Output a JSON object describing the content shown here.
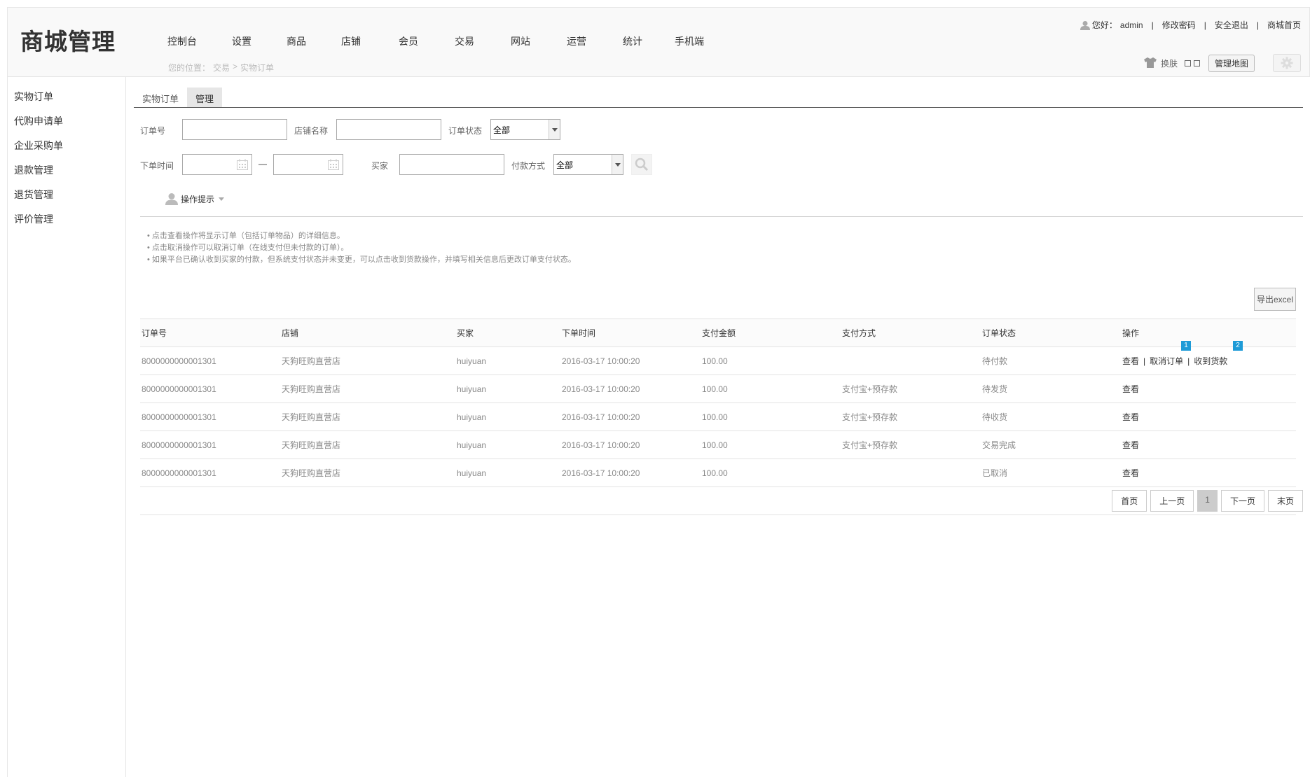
{
  "header": {
    "logo": "商城管理",
    "nav": [
      "控制台",
      "设置",
      "商品",
      "店铺",
      "会员",
      "交易",
      "网站",
      "运营",
      "统计",
      "手机端"
    ],
    "breadcrumb": [
      "您的位置：",
      "交易",
      ">",
      "实物订单"
    ],
    "greeting": "您好：",
    "username": "admin",
    "change_password": "修改密码",
    "logout": "安全退出",
    "store_home": "商城首页",
    "skin": "换肤",
    "site_map": "管理地图"
  },
  "sidebar": {
    "items": [
      "实物订单",
      "代购申请单",
      "企业采购单",
      "退款管理",
      "退货管理",
      "评价管理"
    ]
  },
  "tabs": [
    "实物订单",
    "管理"
  ],
  "filters": {
    "order_no_label": "订单号",
    "store_name_label": "店铺名称",
    "status_label": "订单状态",
    "status_value": "全部",
    "time_label": "下单时间",
    "range_dash": "—",
    "buyer_label": "买家",
    "pay_method_label": "付款方式",
    "pay_method_value": "全部"
  },
  "tips": {
    "toggle": "操作提示",
    "lines": [
      "点击查看操作将显示订单（包括订单物品）的详细信息。",
      "点击取消操作可以取消订单（在线支付但未付款的订单）。",
      "如果平台已确认收到买家的付款，但系统支付状态并未变更，可以点击收到货款操作，并填写相关信息后更改订单支付状态。"
    ]
  },
  "export_label": "导出excel",
  "table": {
    "headers": [
      "订单号",
      "店铺",
      "买家",
      "下单时间",
      "支付金额",
      "支付方式",
      "订单状态",
      "操作"
    ],
    "rows": [
      {
        "order_no": "8000000000001301",
        "store": "天狗旺购直营店",
        "buyer": "huiyuan",
        "time": "2016-03-17 10:00:20",
        "amount": "100.00",
        "pay_method": "",
        "status": "待付款"
      },
      {
        "order_no": "8000000000001301",
        "store": "天狗旺购直营店",
        "buyer": "huiyuan",
        "time": "2016-03-17 10:00:20",
        "amount": "100.00",
        "pay_method": "支付宝+预存款",
        "status": "待发货"
      },
      {
        "order_no": "8000000000001301",
        "store": "天狗旺购直营店",
        "buyer": "huiyuan",
        "time": "2016-03-17 10:00:20",
        "amount": "100.00",
        "pay_method": "支付宝+预存款",
        "status": "待收货"
      },
      {
        "order_no": "8000000000001301",
        "store": "天狗旺购直营店",
        "buyer": "huiyuan",
        "time": "2016-03-17 10:00:20",
        "amount": "100.00",
        "pay_method": "支付宝+预存款",
        "status": "交易完成"
      },
      {
        "order_no": "8000000000001301",
        "store": "天狗旺购直营店",
        "buyer": "huiyuan",
        "time": "2016-03-17 10:00:20",
        "amount": "100.00",
        "pay_method": "",
        "status": "已取消"
      }
    ],
    "ops": {
      "view": "查看",
      "cancel": "取消订单",
      "received": "收到货款",
      "sep": "|",
      "badge1": "1",
      "badge2": "2"
    }
  },
  "pager": {
    "first": "首页",
    "prev": "上一页",
    "current": "1",
    "next": "下一页",
    "last": "末页"
  }
}
